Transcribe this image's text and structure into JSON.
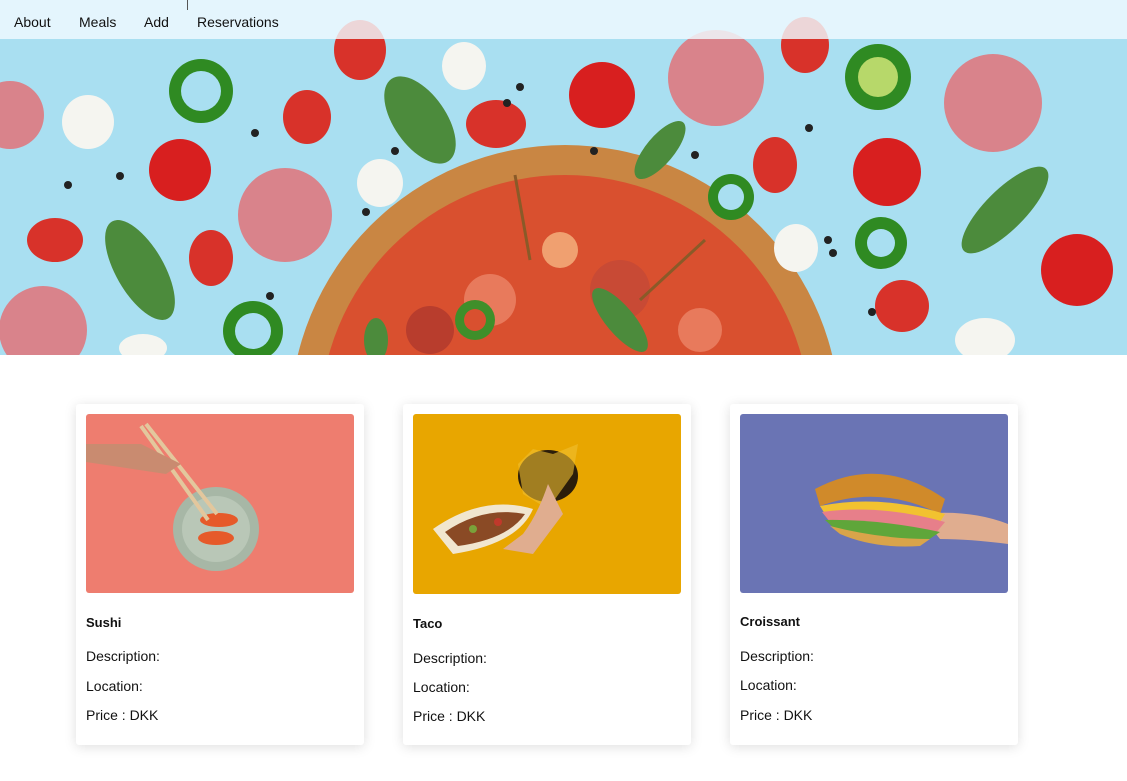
{
  "nav": {
    "items": [
      "About",
      "Meals",
      "Add",
      "Reservations"
    ]
  },
  "hero": {
    "image": "pizza-ingredients-hero",
    "background_color": "#a9dff1"
  },
  "meals": [
    {
      "title": "Sushi",
      "description_label": "Description:",
      "location_label": "Location:",
      "price_label": "Price : DKK",
      "photo": "sushi-photo",
      "photo_bg": "#ee7d6f"
    },
    {
      "title": "Taco",
      "description_label": "Description:",
      "location_label": "Location:",
      "price_label": "Price : DKK",
      "photo": "taco-photo",
      "photo_bg": "#e8a600"
    },
    {
      "title": "Croissant",
      "description_label": "Description:",
      "location_label": "Location:",
      "price_label": "Price : DKK",
      "photo": "croissant-photo",
      "photo_bg": "#6a74b4"
    }
  ]
}
